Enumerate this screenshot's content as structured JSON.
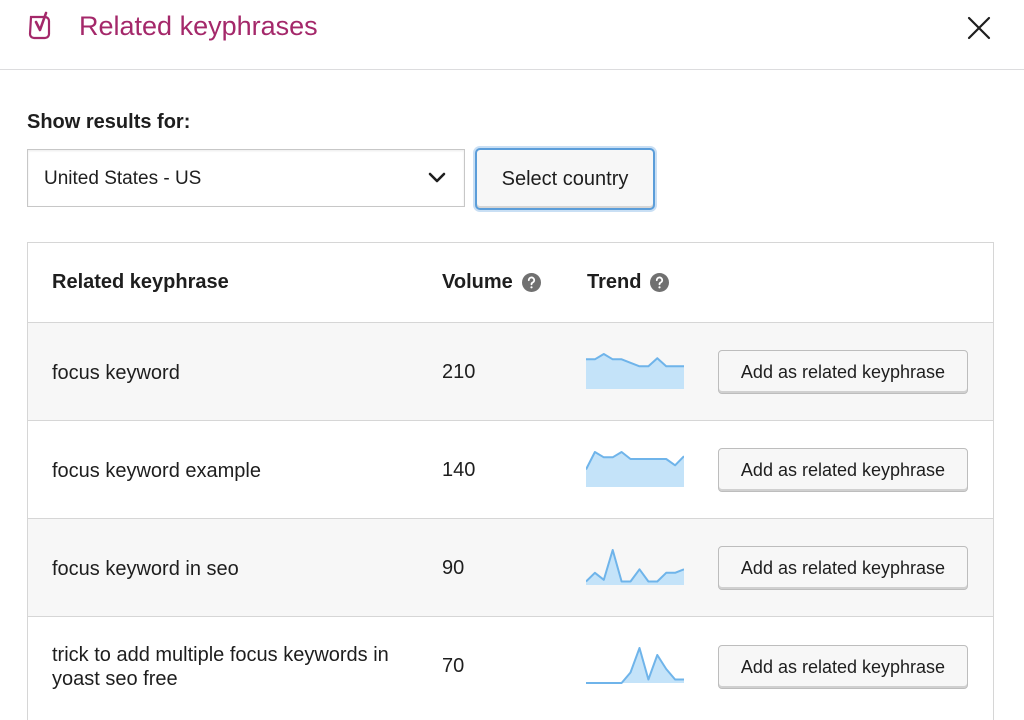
{
  "modal": {
    "title": "Related keyphrases",
    "brand_color": "#a4286a"
  },
  "filter": {
    "label": "Show results for:",
    "country_selected": "United States - US",
    "select_button": "Select country"
  },
  "table": {
    "columns": {
      "keyphrase": "Related keyphrase",
      "volume": "Volume",
      "trend": "Trend"
    },
    "trend_color": "#6fb4ea",
    "trend_fill": "#c4e3f9",
    "rows": [
      {
        "keyphrase": "focus keyword",
        "volume": "210",
        "trend": [
          0.85,
          0.85,
          1.0,
          0.85,
          0.85,
          0.75,
          0.65,
          0.65,
          0.88,
          0.65,
          0.65,
          0.65
        ],
        "action": "Add as related keyphrase"
      },
      {
        "keyphrase": "focus keyword example",
        "volume": "140",
        "trend": [
          0.5,
          1.0,
          0.85,
          0.85,
          1.0,
          0.8,
          0.8,
          0.8,
          0.8,
          0.8,
          0.62,
          0.88
        ],
        "action": "Add as related keyphrase"
      },
      {
        "keyphrase": "focus keyword in seo",
        "volume": "90",
        "trend": [
          0.1,
          0.35,
          0.15,
          1.0,
          0.1,
          0.1,
          0.45,
          0.1,
          0.1,
          0.35,
          0.35,
          0.45
        ],
        "action": "Add as related keyphrase"
      },
      {
        "keyphrase": "trick to add multiple focus keywords in yoast seo free",
        "volume": "70",
        "trend": [
          0.0,
          0.0,
          0.0,
          0.0,
          0.0,
          0.3,
          1.0,
          0.1,
          0.8,
          0.4,
          0.1,
          0.1
        ],
        "action": "Add as related keyphrase"
      }
    ]
  },
  "icons": {
    "logo": "yoast-logo-icon",
    "close": "close-icon",
    "chevron": "chevron-down-icon",
    "help": "help-icon"
  }
}
